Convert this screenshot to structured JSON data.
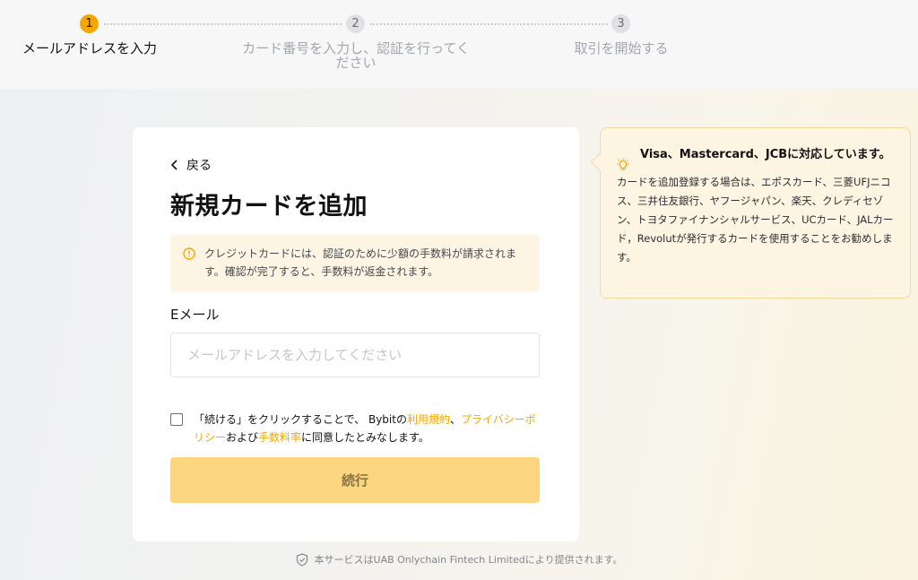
{
  "stepper": {
    "steps": [
      {
        "number": "1",
        "label": "メールアドレスを入力",
        "state": "active"
      },
      {
        "number": "2",
        "label": "カード番号を入力し、認証を行ってください",
        "state": "inactive"
      },
      {
        "number": "3",
        "label": "取引を開始する",
        "state": "inactive"
      }
    ]
  },
  "card": {
    "back_label": "戻る",
    "title": "新規カードを追加",
    "notice": "クレジットカードには、認証のために少額の手数料が請求されます。確認が完了すると、手数料が返金されます。",
    "email_label": "Eメール",
    "email_value": "",
    "email_placeholder": "メールアドレスを入力してください",
    "agree": {
      "checked": false,
      "part1": "「続ける」をクリックすることで、 Bybitの",
      "terms_link": "利用規約",
      "sep1": "、",
      "privacy_link": "プライバシーポリシー",
      "part2": "および",
      "fee_link": "手数料率",
      "part3": "に同意したとみなします。"
    },
    "continue_label": "続行"
  },
  "tip": {
    "title": "Visa、Mastercard、JCBに対応しています。",
    "body": "カードを追加登録する場合は、エポスカード、三菱UFJニコス、三井住友銀行、ヤフージャパン、楽天、クレディセゾン、トヨタファイナンシャルサービス、UCカード、JALカード，Revolutが発行するカードを使用することをお勧めします。"
  },
  "footer": {
    "text": "本サービスはUAB Onlychain Fintech Limitedにより提供されます。"
  },
  "colors": {
    "accent": "#f7a600",
    "button_disabled": "#fbd580",
    "notice_bg": "#fdf4e4",
    "tip_border": "#f6d89a"
  },
  "icons": {
    "back": "chevron-left-icon",
    "notice": "info-circle-icon",
    "tip": "lightbulb-icon",
    "footer": "shield-check-icon"
  }
}
